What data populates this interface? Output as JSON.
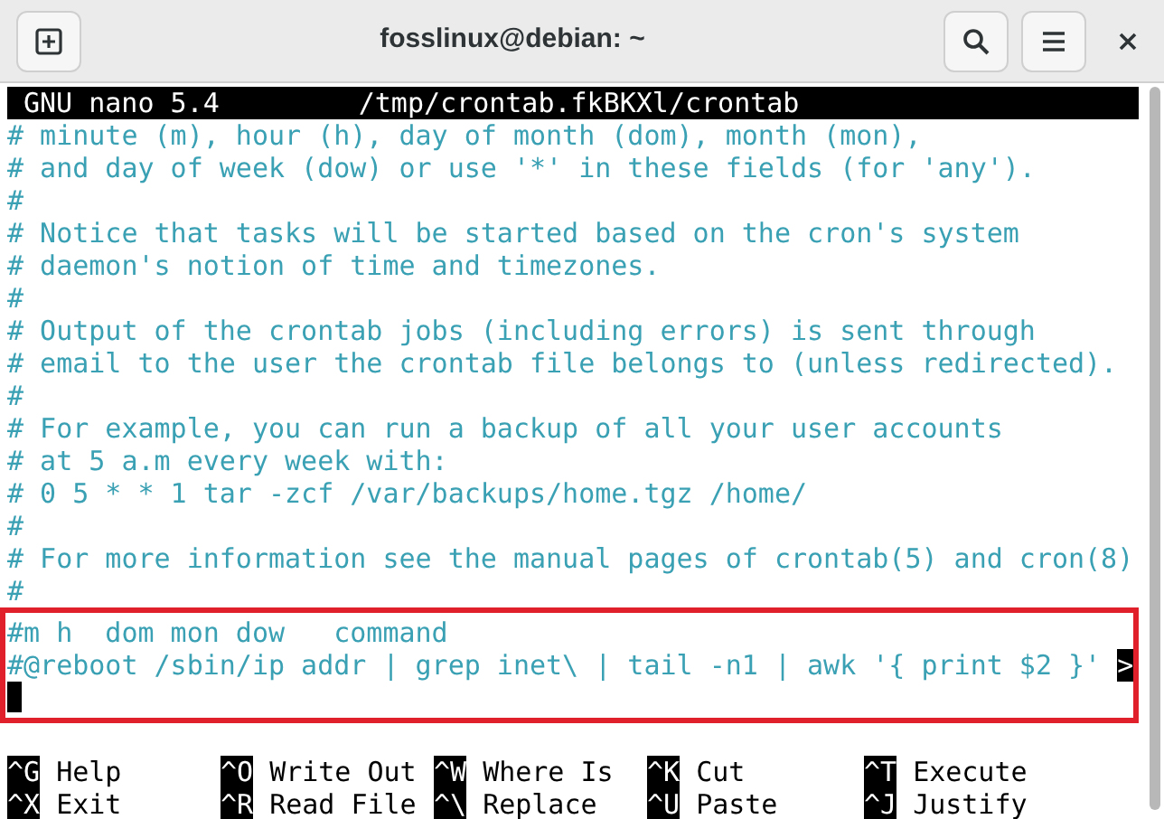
{
  "window": {
    "title": "fosslinux@debian: ~"
  },
  "nano_header": {
    "app": "GNU nano 5.4",
    "file": "/tmp/crontab.fkBKXl/crontab"
  },
  "lines": [
    {
      "text": "# minute (m), hour (h), day of month (dom), month (mon),"
    },
    {
      "text": "# and day of week (dow) or use '*' in these fields (for 'any')."
    },
    {
      "text": "#"
    },
    {
      "text": "# Notice that tasks will be started based on the cron's system"
    },
    {
      "text": "# daemon's notion of time and timezones."
    },
    {
      "text": "#"
    },
    {
      "text": "# Output of the crontab jobs (including errors) is sent through"
    },
    {
      "text": "# email to the user the crontab file belongs to (unless redirected)."
    },
    {
      "text": "#"
    },
    {
      "text": "# For example, you can run a backup of all your user accounts"
    },
    {
      "text": "# at 5 a.m every week with:"
    },
    {
      "text": "# 0 5 * * 1 tar -zcf /var/backups/home.tgz /home/"
    },
    {
      "text": "#"
    },
    {
      "text": "# For more information see the manual pages of crontab(5) and cron(8)"
    },
    {
      "text": "#"
    }
  ],
  "highlighted_lines": [
    {
      "text": "#m h  dom mon dow   command"
    },
    {
      "text": "#@reboot /sbin/ip addr | grep inet\\ | tail -n1 | awk '{ print $2 }'",
      "overflow_marker": ">"
    },
    {
      "cursor": true
    }
  ],
  "shortcuts": [
    {
      "key": "^G",
      "label": "Help"
    },
    {
      "key": "^O",
      "label": "Write Out"
    },
    {
      "key": "^W",
      "label": "Where Is"
    },
    {
      "key": "^K",
      "label": "Cut"
    },
    {
      "key": "^T",
      "label": "Execute"
    },
    {
      "key": "^X",
      "label": "Exit"
    },
    {
      "key": "^R",
      "label": "Read File"
    },
    {
      "key": "^\\",
      "label": "Replace"
    },
    {
      "key": "^U",
      "label": "Paste"
    },
    {
      "key": "^J",
      "label": "Justify"
    }
  ]
}
